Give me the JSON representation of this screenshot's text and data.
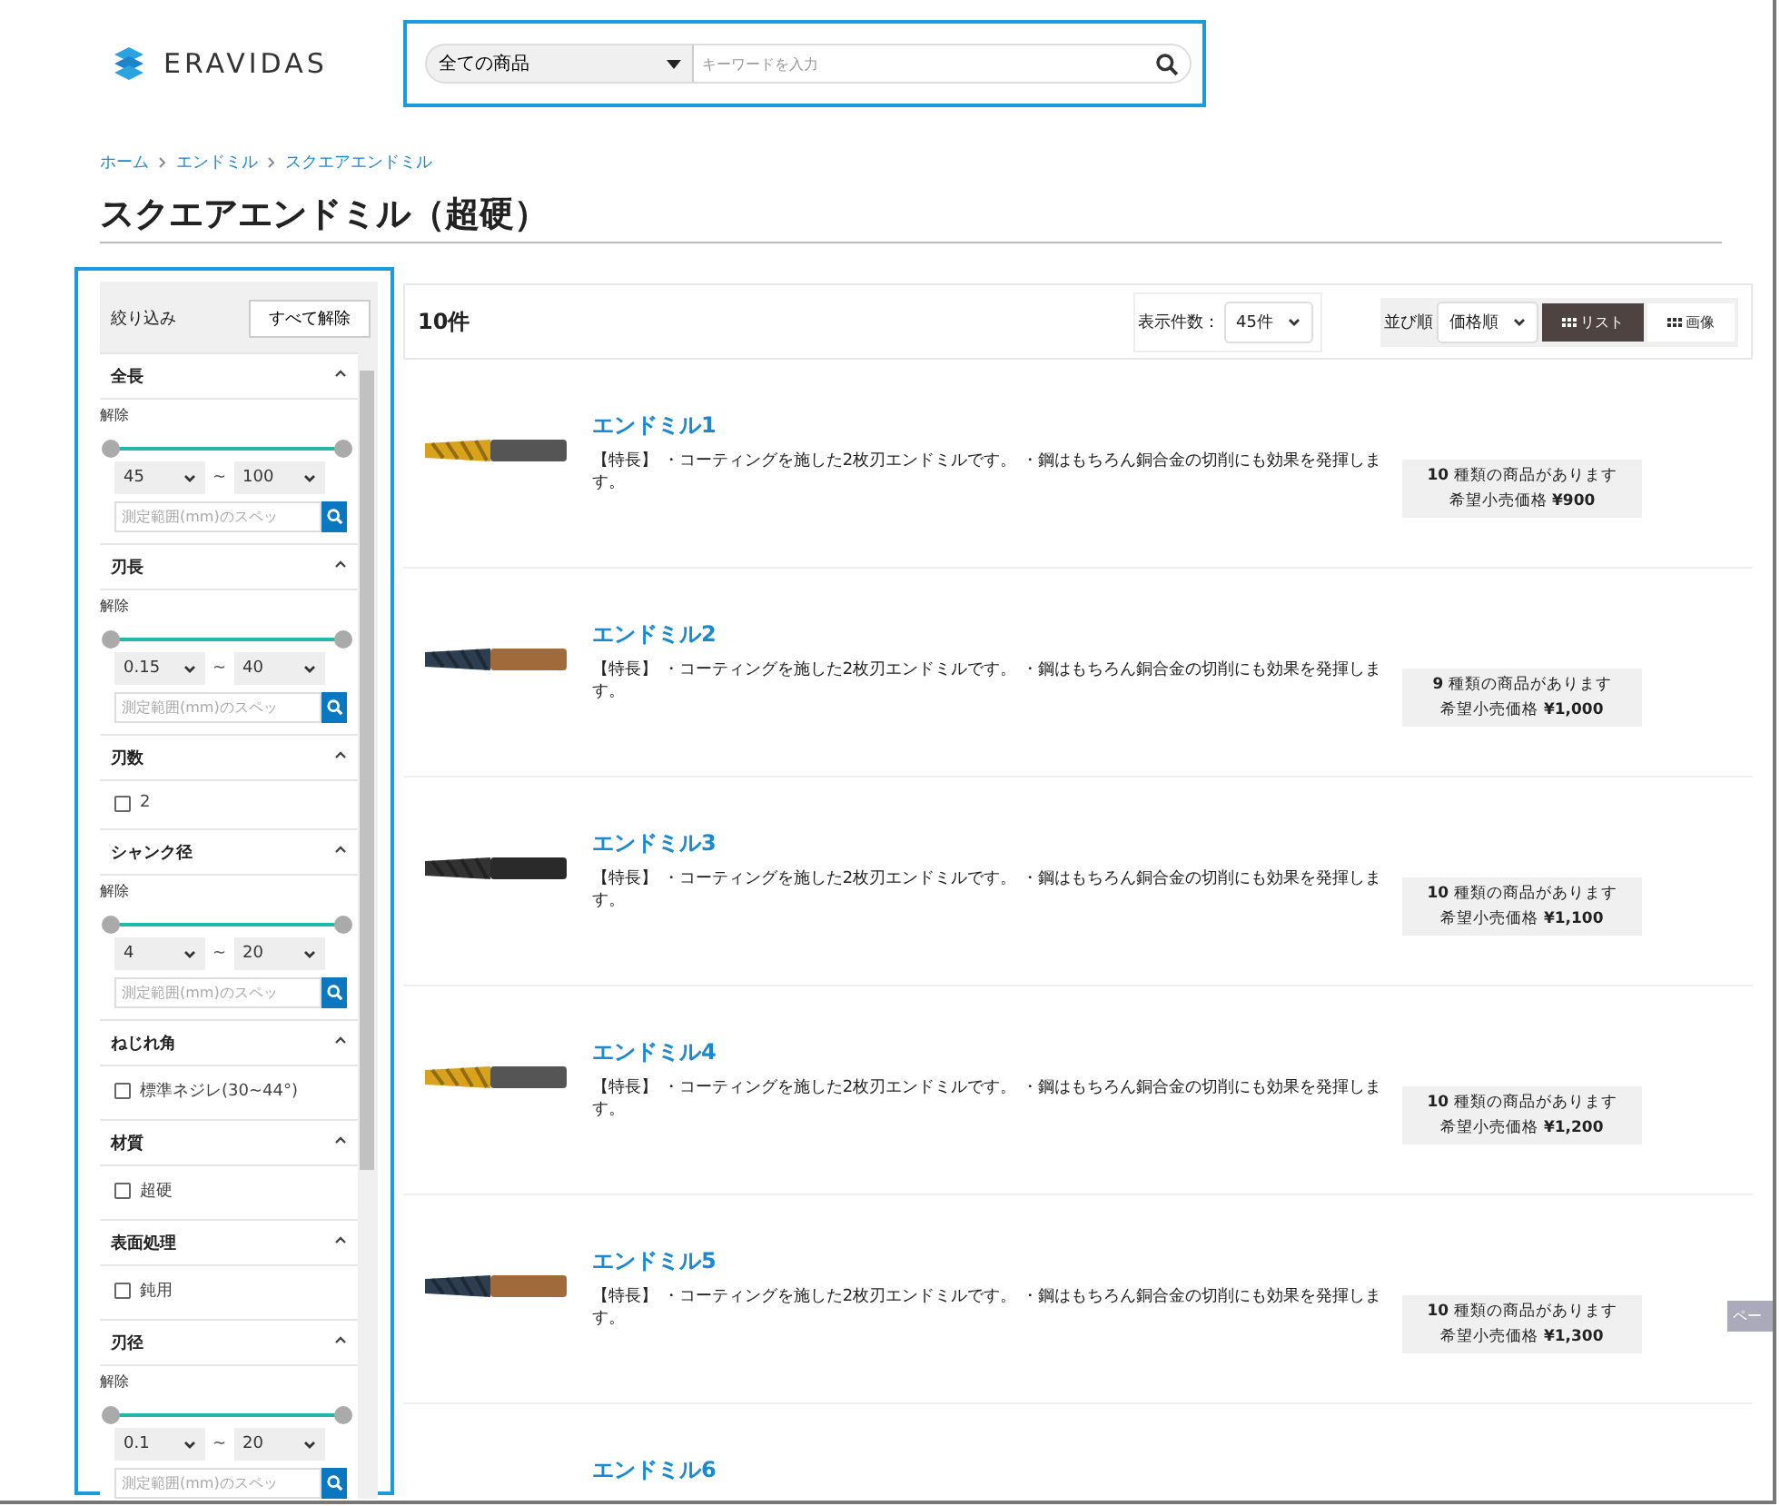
{
  "header": {
    "logo": "ERAVIDAS",
    "search": {
      "category": "全ての商品",
      "placeholder": "キーワードを入力"
    }
  },
  "breadcrumb": [
    "ホーム",
    "エンドミル",
    "スクエアエンドミル"
  ],
  "title": "スクエアエンドミル（超硬）",
  "sidebar": {
    "heading": "絞り込み",
    "clear_all": "すべて解除",
    "filters": [
      {
        "kind": "range",
        "label": "全長",
        "clear": "解除",
        "handles": [
          {
            "level": 0
          },
          {
            "level": 1
          }
        ],
        "min": "45",
        "max": "100",
        "separator": "~",
        "placeholder": "測定範囲(mm)のスペッ"
      },
      {
        "kind": "range",
        "label": "刃長",
        "clear": "解除",
        "handles": [
          {
            "level": 0
          },
          {
            "level": 1
          }
        ],
        "min": "0.15",
        "max": "40",
        "separator": "~",
        "placeholder": "測定範囲(mm)のスペッ"
      },
      {
        "kind": "checkbox",
        "label": "刃数",
        "options": [
          {
            "label": "2",
            "checked": false
          }
        ]
      },
      {
        "kind": "range",
        "label": "シャンク径",
        "clear": "解除",
        "handles": [
          {
            "level": 0
          },
          {
            "level": 1
          }
        ],
        "min": "4",
        "max": "20",
        "separator": "~",
        "placeholder": "測定範囲(mm)のスペッ"
      },
      {
        "kind": "checkbox",
        "label": "ねじれ角",
        "options": [
          {
            "label": "標準ネジレ(30~44°)",
            "checked": false
          }
        ]
      },
      {
        "kind": "checkbox",
        "label": "材質",
        "options": [
          {
            "label": "超硬",
            "checked": false
          }
        ]
      },
      {
        "kind": "checkbox",
        "label": "表面処理",
        "options": [
          {
            "label": "鈍用",
            "checked": false
          }
        ]
      },
      {
        "kind": "range",
        "label": "刃径",
        "clear": "解除",
        "handles": [
          {
            "level": 0
          },
          {
            "level": 1
          }
        ],
        "min": "0.1",
        "max": "20",
        "separator": "~",
        "placeholder": "測定範囲(mm)のスペッ"
      }
    ]
  },
  "toolbar": {
    "count": "10件",
    "per_page_label": "表示件数：",
    "per_page": "45件",
    "sort_label": "並び順",
    "sort": "価格順",
    "views": [
      {
        "label": "リスト",
        "selected": true
      },
      {
        "label": "画像",
        "selected": false
      }
    ]
  },
  "products": [
    {
      "kind": "gold",
      "name": "エンドミル1",
      "description": "【特長】 ・コーティングを施した2枚刃エンドミルです。 ・鋼はもちろん銅合金の切削にも効果を発揮します。",
      "variants": "**10** 種類の商品があります",
      "price": "希望小売価格 **¥900**"
    },
    {
      "kind": "dark",
      "name": "エンドミル2",
      "description": "【特長】 ・コーティングを施した2枚刃エンドミルです。 ・鋼はもちろん銅合金の切削にも効果を発揮します。",
      "variants": "**9** 種類の商品があります",
      "price": "希望小売価格 **¥1,000**"
    },
    {
      "kind": "black",
      "name": "エンドミル3",
      "description": "【特長】 ・コーティングを施した2枚刃エンドミルです。 ・鋼はもちろん銅合金の切削にも効果を発揮します。",
      "variants": "**10** 種類の商品があります",
      "price": "希望小売価格 **¥1,100**"
    },
    {
      "kind": "gold",
      "name": "エンドミル4",
      "description": "【特長】 ・コーティングを施した2枚刃エンドミルです。 ・鋼はもちろん銅合金の切削にも効果を発揮します。",
      "variants": "**10** 種類の商品があります",
      "price": "希望小売価格 **¥1,200**"
    },
    {
      "kind": "dark",
      "name": "エンドミル5",
      "description": "【特長】 ・コーティングを施した2枚刃エンドミルです。 ・鋼はもちろん銅合金の切削にも効果を発揮します。",
      "variants": "**10** 種類の商品があります",
      "price": "希望小売価格 **¥1,300**"
    },
    {
      "kind": "title_only",
      "name": "エンドミル6"
    }
  ],
  "page_tab": "ペー"
}
